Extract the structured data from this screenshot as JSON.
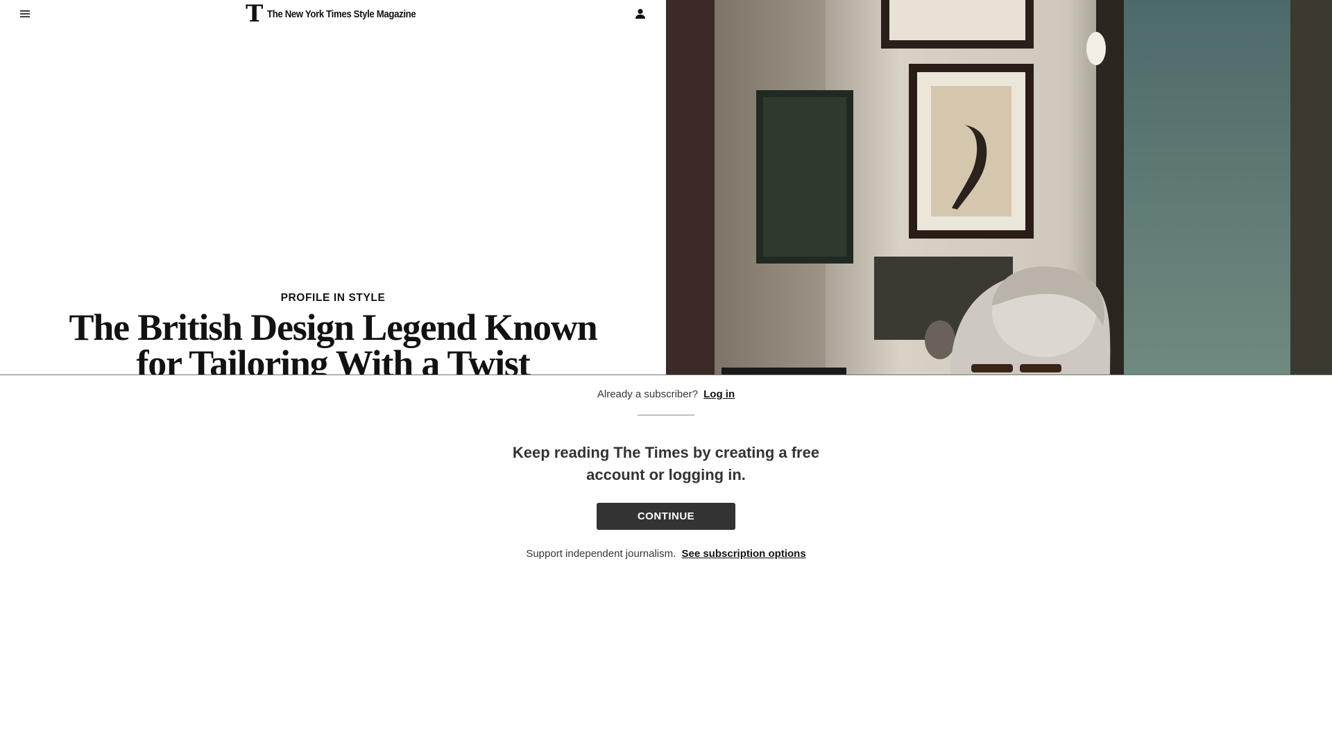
{
  "masthead": {
    "logo_mark": "T",
    "logo_text": "The New York Times Style Magazine",
    "menu_icon": "hamburger-menu-icon",
    "account_icon": "account-person-icon"
  },
  "article": {
    "kicker": "PROFILE IN STYLE",
    "headline": "The British Design Legend Known for Tailoring With a Twist",
    "hero_image": "photo-of-man-with-glasses-in-room-with-framed-art"
  },
  "gate": {
    "already_text": "Already a subscriber?",
    "login_link": "Log in",
    "heading": "Keep reading The Times by creating a free account or logging in.",
    "continue_label": "CONTINUE",
    "support_text": "Support independent journalism.",
    "subscription_link": "See subscription options"
  },
  "colors": {
    "button_bg": "#333333",
    "text_dark": "#121212",
    "text_muted": "#363636",
    "divider": "#6f6f6f"
  }
}
